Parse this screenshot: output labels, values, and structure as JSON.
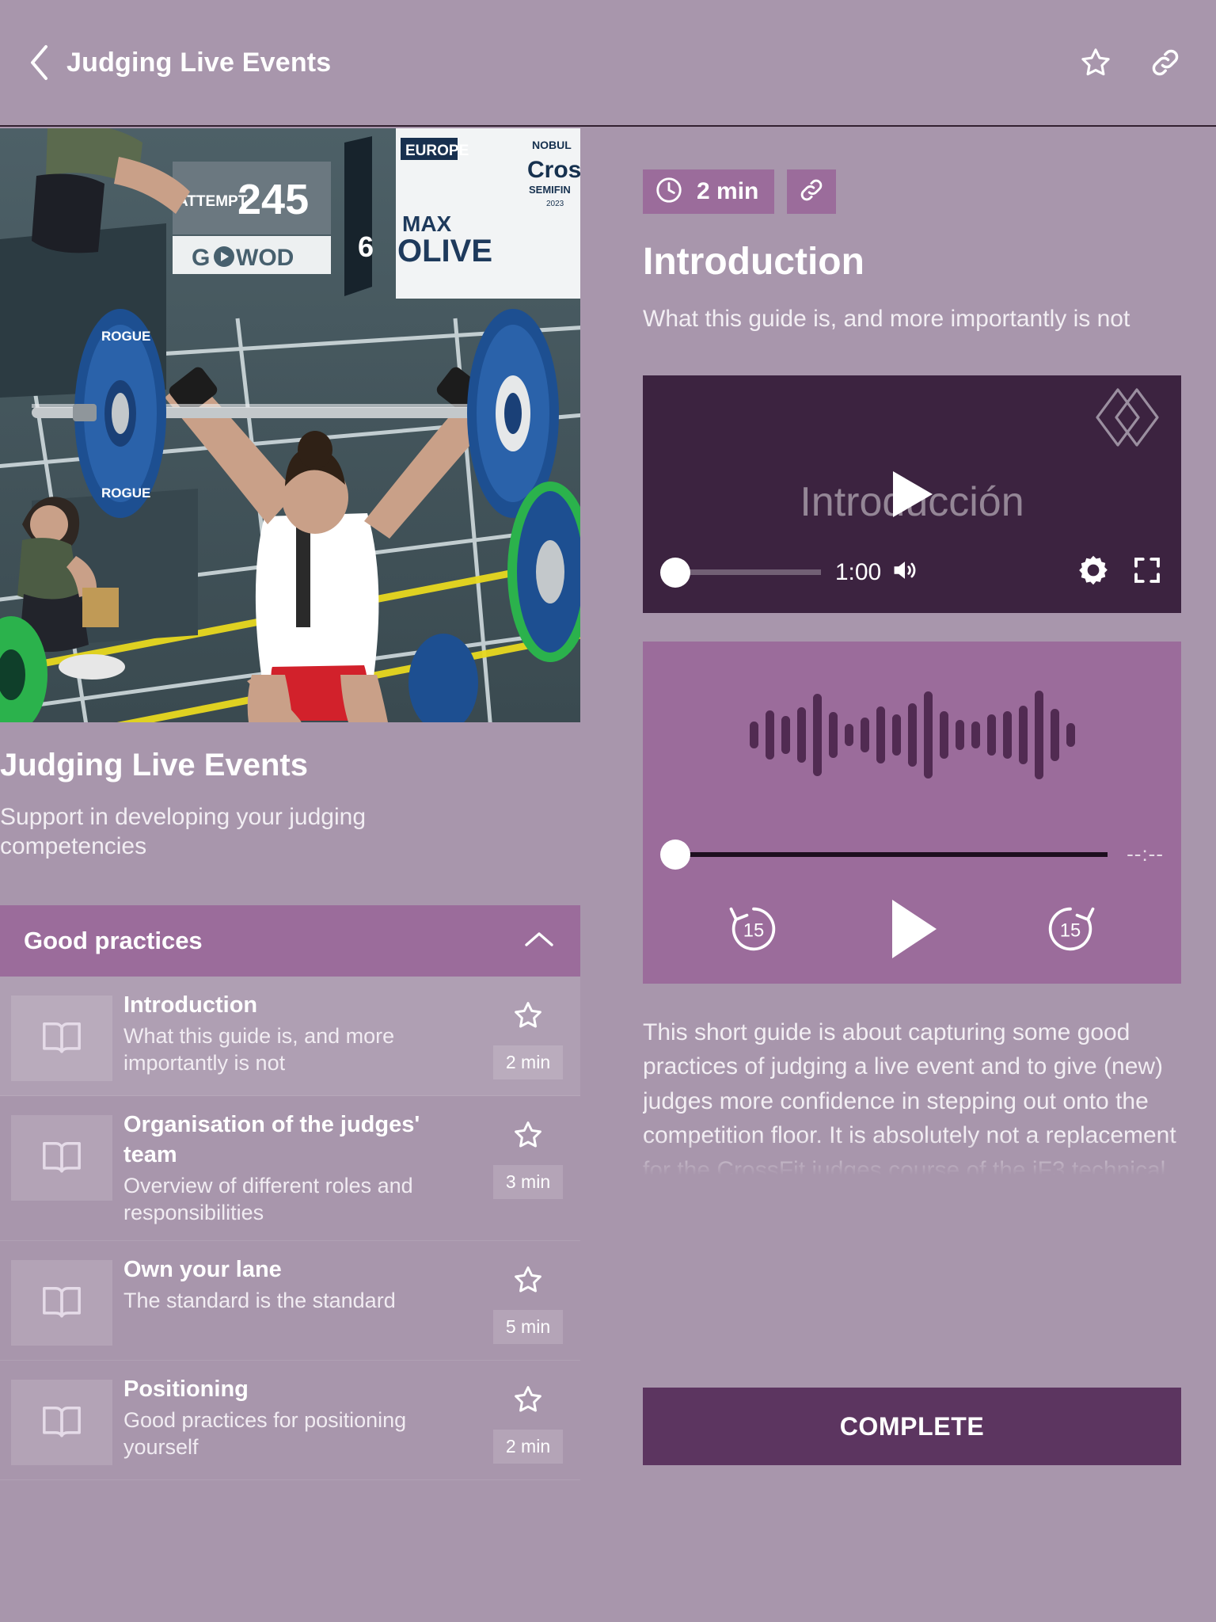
{
  "topbar": {
    "back_icon": "chevron-left-icon",
    "title": "Judging Live Events",
    "favorite_icon": "star-outline-icon",
    "share_icon": "link-icon"
  },
  "course": {
    "hero_image_alt": "weightlifter-overhead-press-competition-photo",
    "hero_scoreboard_attempt_label": "ATTEMPT",
    "hero_scoreboard_value": "245",
    "hero_banner_region": "EUROPE",
    "hero_banner_brand": "CrossFit",
    "hero_banner_event": "SEMIFINALS",
    "hero_banner_year": "2023",
    "hero_sponsor": "GOWOD",
    "hero_athlete_first": "MAX",
    "hero_athlete_last": "OLIVE",
    "hero_lane_number": "6",
    "title": "Judging Live Events",
    "subtitle": "Support in developing your judging competencies"
  },
  "section": {
    "label": "Good practices",
    "collapse_icon": "chevron-up-icon",
    "expanded": true
  },
  "lessons": [
    {
      "icon": "book-icon",
      "title": "Introduction",
      "desc": "What this guide is, and more importantly is not",
      "favorite_icon": "star-outline-icon",
      "duration": "2 min",
      "active": true
    },
    {
      "icon": "book-icon",
      "title": "Organisation of the judges' team",
      "desc": "Overview of different roles and responsibilities",
      "favorite_icon": "star-outline-icon",
      "duration": "3 min",
      "active": false
    },
    {
      "icon": "book-icon",
      "title": "Own your lane",
      "desc": "The standard is the standard",
      "favorite_icon": "star-outline-icon",
      "duration": "5 min",
      "active": false
    },
    {
      "icon": "book-icon",
      "title": "Positioning",
      "desc": "Good practices for positioning yourself",
      "favorite_icon": "star-outline-icon",
      "duration": "2 min",
      "active": false
    }
  ],
  "detail": {
    "clock_icon": "clock-icon",
    "duration": "2 min",
    "share_icon": "link-icon",
    "title": "Introduction",
    "subtitle": "What this guide is, and more importantly is not",
    "body": "This short guide is about capturing some good practices of judging a live event and to give (new) judges more confidence in stepping out onto the competition floor. It is absolutely not a replacement for the CrossFit judges course of the iF3 technical official courses, and we ... . This means we do not ..."
  },
  "video": {
    "logo_icon": "diamond-logo-icon",
    "title": "Introducción",
    "play_icon": "play-icon",
    "progress_percent": 0,
    "time": "1:00",
    "volume_icon": "volume-up-icon",
    "settings_icon": "gear-icon",
    "fullscreen_icon": "fullscreen-icon"
  },
  "audio": {
    "waveform_icon": "audio-waveform-icon",
    "waveform": [
      34,
      62,
      48,
      70,
      104,
      58,
      28,
      44,
      72,
      52,
      80,
      110,
      60,
      38,
      34,
      52,
      60,
      74,
      112,
      66,
      30
    ],
    "progress_percent": 0,
    "time": "--:--",
    "rewind_icon": "replay-15-icon",
    "rewind_label": "15",
    "play_icon": "play-icon",
    "forward_icon": "forward-15-icon",
    "forward_label": "15"
  },
  "footer": {
    "complete_label": "COMPLETE"
  },
  "colors": {
    "page_background": "#a896ac",
    "accent": "#9b6c9b",
    "video_background": "#3c2340",
    "button": "#5c3560",
    "text": "#ffffff"
  }
}
